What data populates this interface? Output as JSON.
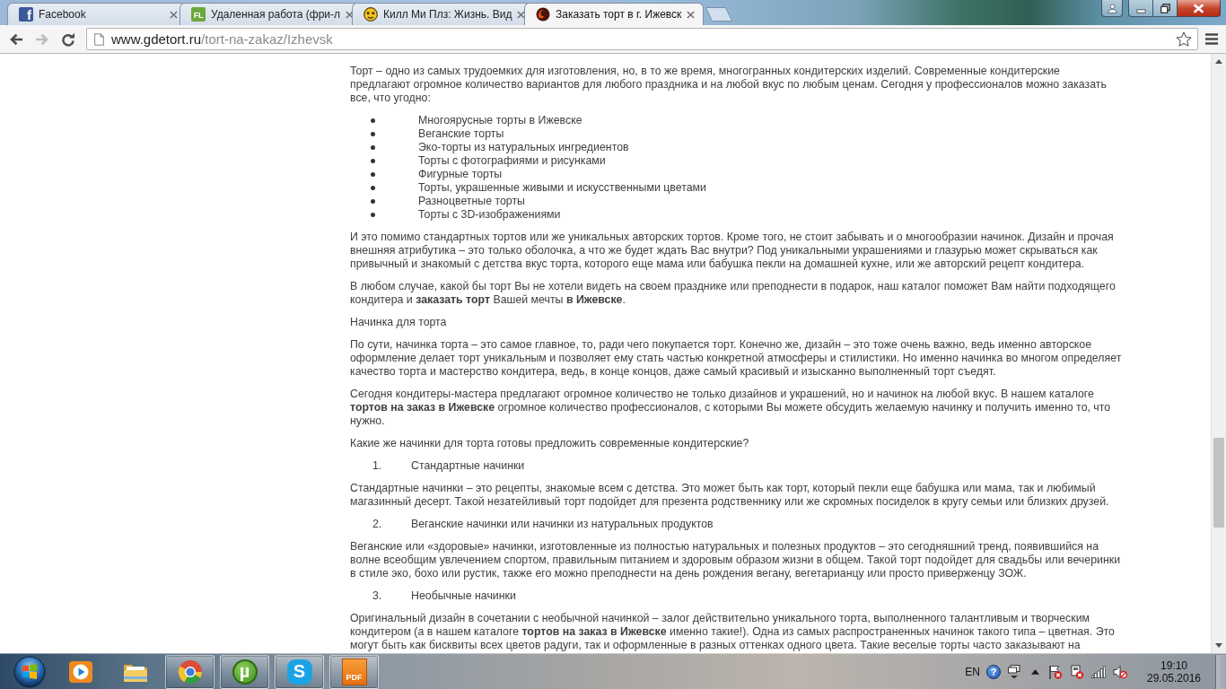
{
  "browser": {
    "tabs": [
      {
        "title": "Facebook",
        "favicon_text": "f",
        "selected": false
      },
      {
        "title": "Удаленная работа (фри-л",
        "favicon_text": "FL",
        "selected": false
      },
      {
        "title": "Килл Ми Плз: Жизнь. Вид",
        "selected": false
      },
      {
        "title": "Заказать торт в г. Ижевск",
        "selected": true
      }
    ],
    "toolbar": {
      "nav_buttons": [
        {
          "kind": "back",
          "disabled": false
        },
        {
          "kind": "forward",
          "disabled": true
        },
        {
          "kind": "reload",
          "disabled": false
        }
      ],
      "address": {
        "host": "www.gdetort.ru",
        "path": "/tort-na-zakaz/Izhevsk"
      }
    }
  },
  "article": {
    "blocks": [
      {
        "kind": "paragraph",
        "text": "Торт – одно из самых трудоемких для изготовления, но, в то же время, многогранных кондитерских изделий. Современные кондитерские предлагают огромное количество вариантов для любого праздника и на любой вкус по любым ценам. Сегодня у профессионалов можно заказать все, что угодно:"
      },
      {
        "kind": "bullet_list",
        "items": [
          "Многоярусные торты в Ижевске",
          "Веганские торты",
          "Эко-торты из натуральных ингредиентов",
          "Торты с фотографиями и рисунками",
          "Фигурные торты",
          "Торты, украшенные живыми и искусственными цветами",
          "Разноцветные торты",
          "Торты с 3D-изображениями"
        ]
      },
      {
        "kind": "paragraph",
        "text": "И это помимо стандартных тортов или же уникальных авторских тортов. Кроме того, не стоит забывать и о многообразии начинок. Дизайн и прочая внешняя атрибутика – это только оболочка, а что же будет ждать Вас внутри? Под уникальными украшениями и глазурью может скрываться как привычный и знакомый с детства вкус торта, которого еще мама или бабушка пекли на домашней кухне, или же авторский рецепт кондитера."
      },
      {
        "kind": "paragraph",
        "text": "В любом случае, какой бы торт Вы не хотели видеть на своем празднике или преподнести в подарок, наш каталог поможет Вам найти подходящего кондитера и **заказать торт** Вашей мечты **в Ижевске**."
      },
      {
        "kind": "paragraph",
        "text": "Начинка для торта"
      },
      {
        "kind": "paragraph",
        "text": "По сути, начинка торта – это самое главное, то, ради чего покупается торт. Конечно же, дизайн – это тоже очень важно, ведь именно авторское оформление делает торт уникальным и позволяет ему стать частью конкретной атмосферы и стилистики. Но именно начинка во многом определяет качество торта и мастерство кондитера, ведь, в конце концов, даже самый красивый и изысканно выполненный торт съедят."
      },
      {
        "kind": "paragraph",
        "text": "Сегодня кондитеры-мастера предлагают огромное количество не только дизайнов и украшений, но и начинок на любой вкус. В нашем каталоге **тортов на заказ в Ижевске** огромное количество профессионалов, с которыми Вы можете обсудить желаемую начинку и получить именно то, что нужно."
      },
      {
        "kind": "paragraph",
        "text": "Какие же начинки для торта готовы предложить современные кондитерские?"
      },
      {
        "kind": "numbered_item",
        "number": "1.",
        "text": "Стандартные начинки"
      },
      {
        "kind": "paragraph",
        "text": "Стандартные начинки – это рецепты, знакомые всем с детства. Это может быть как торт, который пекли еще бабушка или мама, так и любимый магазинный десерт. Такой незатейливый торт подойдет для презента родственнику или же скромных посиделок в кругу семьи или близких друзей."
      },
      {
        "kind": "numbered_item",
        "number": "2.",
        "text": "Веганские начинки или начинки из натуральных продуктов"
      },
      {
        "kind": "paragraph",
        "text": "Веганские или «здоровые» начинки, изготовленные из полностью натуральных и полезных продуктов – это сегодняшний тренд, появившийся на волне всеобщим увлечением спортом, правильным питанием и здоровым образом жизни в общем. Такой торт подойдет для свадьбы или вечеринки в стиле эко, бохо или рустик, также его можно преподнести на день рождения вегану, вегетарианцу или просто приверженцу ЗОЖ."
      },
      {
        "kind": "numbered_item",
        "number": "3.",
        "text": "Необычные начинки"
      },
      {
        "kind": "paragraph",
        "text": "Оригинальный дизайн в сочетании с необычной начинкой – залог действительно уникального торта, выполненного талантливым и творческим кондитером (а в нашем каталоге **тортов на заказ в Ижевске** именно такие!). Одна из самых распространенных начинок такого типа – цветная. Это могут быть как бисквиты всех цветов радуги, так и оформленные в разных оттенках одного цвета. Такие веселые торты часто заказывают на"
      }
    ]
  },
  "taskbar": {
    "apps": [
      {
        "kind": "media",
        "running": false
      },
      {
        "kind": "folder",
        "running": false
      },
      {
        "kind": "browser",
        "running": true
      },
      {
        "kind": "torrent",
        "glyph": "µ",
        "running": true
      },
      {
        "kind": "chat",
        "glyph": "S",
        "running": true
      },
      {
        "kind": "pdf",
        "glyph": "PDF",
        "running": true
      }
    ],
    "tray": {
      "language": "EN",
      "help_glyph": "?",
      "time": "19:10",
      "date": "29.05.2016"
    }
  }
}
